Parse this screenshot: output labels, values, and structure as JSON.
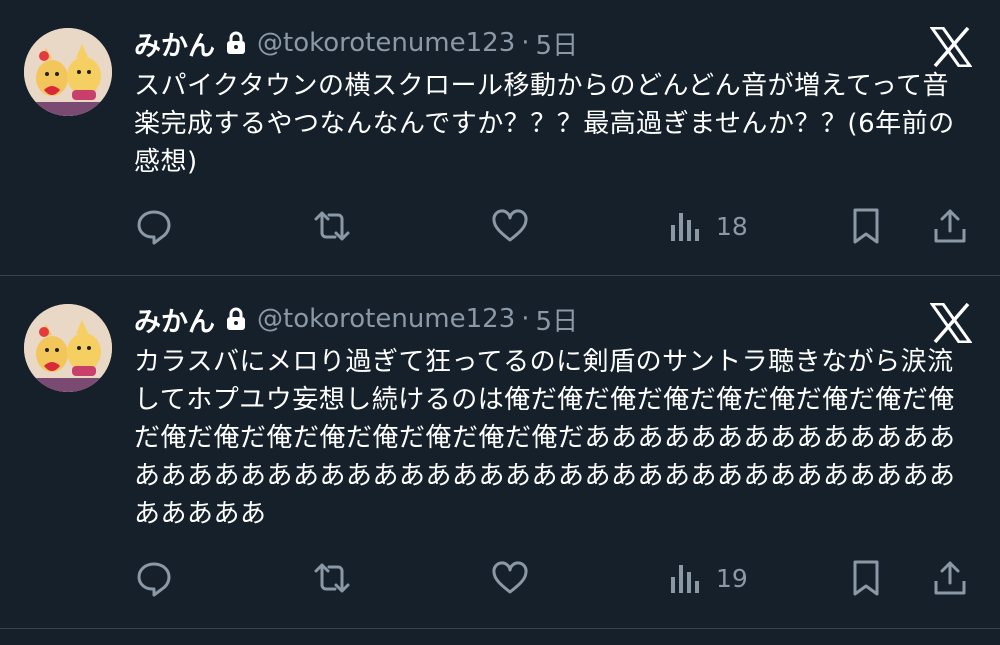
{
  "theme": {
    "background": "#15202b",
    "text": "#ffffff",
    "muted": "#8b98a5",
    "divider": "#38444d"
  },
  "tweets": [
    {
      "name": "みかん",
      "handle": "@tokorotenume123",
      "separator": "·",
      "time": "5日",
      "text": "スパイクタウンの横スクロール移動からのどんどん音が増えてって音楽完成するやつなんなんですか？？？最高過ぎませんか？？(6年前の感想)",
      "views": "18",
      "icons": [
        "lock-icon",
        "x-logo-icon",
        "reply-icon",
        "retweet-icon",
        "like-icon",
        "views-icon",
        "bookmark-icon",
        "share-icon"
      ]
    },
    {
      "name": "みかん",
      "handle": "@tokorotenume123",
      "separator": "·",
      "time": "5日",
      "text": "カラスバにメロり過ぎて狂ってるのに剣盾のサントラ聴きながら涙流してホプユウ妄想し続けるのは俺だ俺だ俺だ俺だ俺だ俺だ俺だ俺だ俺だ俺だ俺だ俺だ俺だ俺だ俺だ俺だ俺だああああああああああああああああああああああああああああああああああああああああああああああああああ",
      "views": "19",
      "icons": [
        "lock-icon",
        "x-logo-icon",
        "reply-icon",
        "retweet-icon",
        "like-icon",
        "views-icon",
        "bookmark-icon",
        "share-icon"
      ]
    }
  ]
}
